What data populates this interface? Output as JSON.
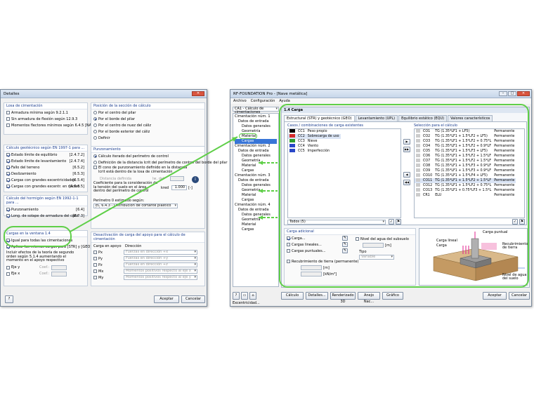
{
  "left": {
    "title": "Detalles",
    "losa": {
      "title": "Losa de cimentación",
      "items": [
        {
          "label": "Armadura mínima según 9.2.1.1",
          "checked": false
        },
        {
          "label": "Sin armadura de flexión según 12.9.3",
          "checked": false
        },
        {
          "label": "Momentos flectores mínimos según 6.4.5 [NA 6.6]",
          "checked": false
        }
      ]
    },
    "posicion": {
      "title": "Posición de la sección de cálculo",
      "items": [
        {
          "label": "Por el centro del pilar",
          "on": false
        },
        {
          "label": "Por el borde del pilar",
          "on": true
        },
        {
          "label": "Por el centro de nuez del cáliz",
          "on": false
        },
        {
          "label": "Por el borde exterior del cáliz",
          "on": false
        },
        {
          "label": "Definir",
          "on": false
        }
      ]
    },
    "geotecnico": {
      "title": "Cálculo geotécnico según EN 1997-1 para ...",
      "items": [
        {
          "label": "Estado límite de equilibrio",
          "ref": "[2.4.7.2]",
          "checked": true
        },
        {
          "label": "Estado límite de levantamiento",
          "ref": "[2.4.7.4]",
          "checked": true
        },
        {
          "label": "Fallo del terreno",
          "ref": "[6.5.2]",
          "checked": true
        },
        {
          "label": "Deslizamiento",
          "ref": "[6.5.3]",
          "checked": true
        },
        {
          "label": "Cargas con grandes excentricidades",
          "ref": "[6.5.4]",
          "checked": true
        },
        {
          "label": "Cargas con grandes excentr. en núcleo",
          "ref": "[A 6.6.5]",
          "checked": true
        }
      ]
    },
    "punzonamiento": {
      "title": "Punzonamiento",
      "items": [
        {
          "label": "Cálculo iterado del perímetro de control",
          "on": true
        },
        {
          "label": "Definición de la distancia lcrit del perímetro de control del borde del pilar",
          "on": false
        }
      ],
      "cono": "El cono de punzonamiento definido en la distancia lcrit está dentro de la losa de cimentación",
      "distancia": "Distancia definida",
      "lw": "lw, def",
      "coef": "Coeficiente para la consideración de la tensión del suelo en el área dentro del perímetro de control",
      "kred": "kred",
      "kval": "1.000",
      "unit": "[-]",
      "perimetro": "Perímetro 0 estimado según:",
      "perim_val": "EC 6.4.3 - Distribución de cortante plástico tota"
    },
    "hormigon": {
      "title": "Cálculo del hormigón según EN 1992-1-1 para ...",
      "items": [
        {
          "label": "Punzonamiento",
          "ref": "[6.4]",
          "checked": true
        },
        {
          "label": "Long. de solape de armadura del cáliz",
          "ref": "[8.7.3]",
          "checked": true
        }
      ]
    },
    "cargas": {
      "title": "Cargas en la ventana 1.4",
      "items": [
        {
          "label": "Igual para todas las cimentaciones",
          "checked": true
        },
        {
          "label": "Aplicar las mismas cargas para [STR] y [GEO]",
          "checked": true
        }
      ],
      "note": "Incluir efectos de la teoría de segundo orden según 5.1.4 aumentando el momento en el apoyo respectivo",
      "eje_y": "Eje y",
      "eje_x": "Eje x",
      "coef": "Coef.:"
    },
    "desactivacion": {
      "title": "Desactivación de carga del apoyo para el cálculo de cimentación",
      "col1": "Carga en apoyo",
      "col2": "Dirección",
      "rows": [
        {
          "c": "Px",
          "d": "Fuerzas en dirección +x"
        },
        {
          "c": "Py",
          "d": "Fuerzas en dirección +y"
        },
        {
          "c": "Pz",
          "d": "Fuerzas en dirección +z"
        },
        {
          "c": "Mx",
          "d": "Momentos positivos respecto al eje x"
        },
        {
          "c": "My",
          "d": "Momentos positivos respecto al eje y"
        }
      ]
    },
    "ok": "Aceptar",
    "cancel": "Cancelar"
  },
  "right": {
    "title": "RF-FOUNDATION Pro - [Nave metálica]",
    "menu": [
      "Archivo",
      "Configuración",
      "Ayuda"
    ],
    "case": "CA1 - Cálculo de cimentaciones",
    "tree": [
      {
        "t": "Cimentación núm. 1",
        "l": 0
      },
      {
        "t": "Datos de entrada",
        "l": 1
      },
      {
        "t": "Datos generales",
        "l": 2
      },
      {
        "t": "Geometría",
        "l": 2
      },
      {
        "t": "Material",
        "l": 2
      },
      {
        "t": "Cargas",
        "l": 2,
        "sel": true
      },
      {
        "t": "Cimentación núm. 2",
        "l": 0
      },
      {
        "t": "Datos de entrada",
        "l": 1
      },
      {
        "t": "Datos generales",
        "l": 2
      },
      {
        "t": "Geometría",
        "l": 2
      },
      {
        "t": "Material",
        "l": 2
      },
      {
        "t": "Cargas",
        "l": 2
      },
      {
        "t": "Cimentación núm. 3",
        "l": 0
      },
      {
        "t": "Datos de entrada",
        "l": 1
      },
      {
        "t": "Datos generales",
        "l": 2
      },
      {
        "t": "Geometría",
        "l": 2
      },
      {
        "t": "Material",
        "l": 2
      },
      {
        "t": "Cargas",
        "l": 2
      },
      {
        "t": "Cimentación núm. 4",
        "l": 0
      },
      {
        "t": "Datos de entrada",
        "l": 1
      },
      {
        "t": "Datos generales",
        "l": 2
      },
      {
        "t": "Geometría",
        "l": 2
      },
      {
        "t": "Material",
        "l": 2
      },
      {
        "t": "Cargas",
        "l": 2
      }
    ],
    "panel_title": "1.4 Carga",
    "tabs": [
      "Estructural (STR) y geotécnico (GEO)",
      "Levantamiento (UPL)",
      "Equilibrio estático (EQU)",
      "Valores característicos"
    ],
    "existing_title": "Casos / combinaciones de carga existentes",
    "existing": [
      {
        "id": "CC1",
        "name": "Peso propio",
        "color": "#000000"
      },
      {
        "id": "CC2",
        "name": "Sobrecarga de uso",
        "color": "#d42b2b"
      },
      {
        "id": "CC3",
        "name": "Nieve",
        "color": "#2f9e2f"
      },
      {
        "id": "CC4",
        "name": "Viento",
        "color": "#2a48c8"
      },
      {
        "id": "CC5",
        "name": "Imperfección",
        "color": "#2a48c8"
      }
    ],
    "sel_title": "Selección para el cálculo",
    "selection": [
      {
        "id": "CO1",
        "f": "TG  (1.35*LF1 + LF5)",
        "t": "Permanente"
      },
      {
        "id": "CO2",
        "f": "TG  (1.35*LF1 + 1.5*LF2 + LF5)",
        "t": "Permanente"
      },
      {
        "id": "CO3",
        "f": "TG  (1.35*LF1 + 1.5*LF2 + 0.75*L",
        "t": "Permanente"
      },
      {
        "id": "CO4",
        "f": "TG  (1.35*LF1 + 1.5*LF2 + 0.9*LF",
        "t": "Permanente"
      },
      {
        "id": "CO5",
        "f": "TG  (1.35*LF1 + 1.5*LF3 + LF5)",
        "t": "Permanente"
      },
      {
        "id": "CO6",
        "f": "TG  (1.35*LF1 + 1.5*LF2 + 1.5*LF",
        "t": "Permanente"
      },
      {
        "id": "CO7",
        "f": "TG  (1.35*LF1 + 1.5*LF2 + 1.5*LF",
        "t": "Permanente"
      },
      {
        "id": "CO8",
        "f": "TG  (1.35*LF1 + 1.5*LF3 + 0.9*LF",
        "t": "Permanente"
      },
      {
        "id": "CO9",
        "f": "TG  (1.35*LF1 + 1.5*LF3 + 0.9*LF",
        "t": "Permanente"
      },
      {
        "id": "CO10",
        "f": "TG  (1.35*LF1 + 1.5*LF4 + LF5)",
        "t": "Permanente"
      },
      {
        "id": "CO11",
        "f": "TG  (1.35*LF1 + 1.5*LF2 + 1.5*LF",
        "t": "Permanente"
      },
      {
        "id": "CO12",
        "f": "TG  (1.35*LF1 + 1.5*LF2 + 0.75*L",
        "t": "Permanente"
      },
      {
        "id": "CO13",
        "f": "TG  (1.35*LF1 + 0.75*LF3 + 1.5*L",
        "t": "Permanente"
      },
      {
        "id": "CR1",
        "f": "ELU",
        "t": "Permanente"
      }
    ],
    "todos": "Todos (5)",
    "adicional_title": "Carga adicional",
    "adicional": [
      {
        "label": "Carga...",
        "checked": true
      },
      {
        "label": "Cargas lineales...",
        "checked": false
      },
      {
        "label": "Cargas puntuales...",
        "checked": false
      }
    ],
    "nivel": "Nivel del agua del subsuelo",
    "tipo": "Tipo",
    "tipo_val": "Variable",
    "recub": "Recubrimiento de tierra (permanente)",
    "u_m": "[m]",
    "u_kn": "[kN/m³]",
    "fig": {
      "carga_puntual": "Carga puntual",
      "carga_lineal": "Carga lineal",
      "carga": "Carga",
      "recub": "Recubrimiento de tierra",
      "nivel": "Nivel de agua del suelo"
    },
    "buttons": [
      "Cálculo",
      "Detalles...",
      "Renderizado 3D",
      "Anejo Nac...",
      "Gráfico"
    ],
    "ok": "Aceptar",
    "cancel": "Cancelar",
    "status": "Excentricidad..."
  },
  "colors": {
    "highlight": "#5fcf48",
    "title_blue": "#1a3d8f"
  }
}
